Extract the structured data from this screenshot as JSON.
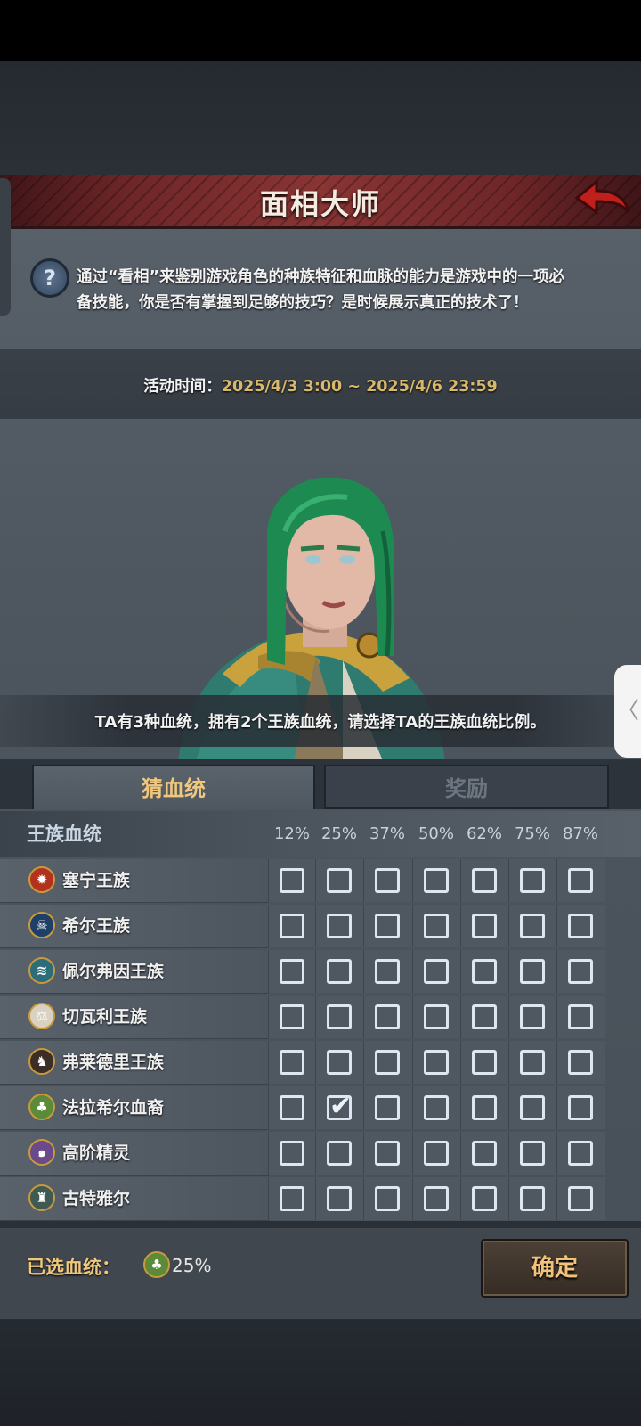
{
  "title": "面相大师",
  "description": "通过“看相”来鉴别游戏角色的种族特征和血脉的能力是游戏中的一项必备技能，你是否有掌握到足够的技巧？是时候展示真正的技术了！",
  "event_time": {
    "label": "活动时间：",
    "value": "2025/4/3 3:00 ~ 2025/4/6 23:59"
  },
  "clue": "TA有3种血统，拥有2个王族血统，请选择TA的王族血统比例。",
  "tabs": [
    "猜血统",
    "奖励"
  ],
  "table": {
    "header": "王族血统",
    "percentages": [
      "12%",
      "25%",
      "37%",
      "50%",
      "62%",
      "75%",
      "87%"
    ],
    "rows": [
      {
        "name": "塞宁王族",
        "emblem": "sun-emblem-icon",
        "color": "#b3321e",
        "checked": [
          false,
          false,
          false,
          false,
          false,
          false,
          false
        ]
      },
      {
        "name": "希尔王族",
        "emblem": "skull-emblem-icon",
        "color": "#1e3f66",
        "checked": [
          false,
          false,
          false,
          false,
          false,
          false,
          false
        ]
      },
      {
        "name": "佩尔弗因王族",
        "emblem": "wave-emblem-icon",
        "color": "#2d6d7a",
        "checked": [
          false,
          false,
          false,
          false,
          false,
          false,
          false
        ]
      },
      {
        "name": "切瓦利王族",
        "emblem": "scales-emblem-icon",
        "color": "#d9d2c2",
        "checked": [
          false,
          false,
          false,
          false,
          false,
          false,
          false
        ]
      },
      {
        "name": "弗莱德里王族",
        "emblem": "beast-emblem-icon",
        "color": "#3a2e26",
        "checked": [
          false,
          false,
          false,
          false,
          false,
          false,
          false
        ]
      },
      {
        "name": "法拉希尔血裔",
        "emblem": "tree-emblem-icon",
        "color": "#5b8a3a",
        "checked": [
          false,
          true,
          false,
          false,
          false,
          false,
          false
        ]
      },
      {
        "name": "高阶精灵",
        "emblem": "spiral-emblem-icon",
        "color": "#6a4a8a",
        "checked": [
          false,
          false,
          false,
          false,
          false,
          false,
          false
        ]
      },
      {
        "name": "古特雅尔",
        "emblem": "crest-emblem-icon",
        "color": "#3e5a52",
        "checked": [
          false,
          false,
          false,
          false,
          false,
          false,
          false
        ]
      }
    ]
  },
  "selected": {
    "label": "已选血统：",
    "emblem": "tree-emblem-icon",
    "value": "25%"
  },
  "confirm_label": "确定"
}
